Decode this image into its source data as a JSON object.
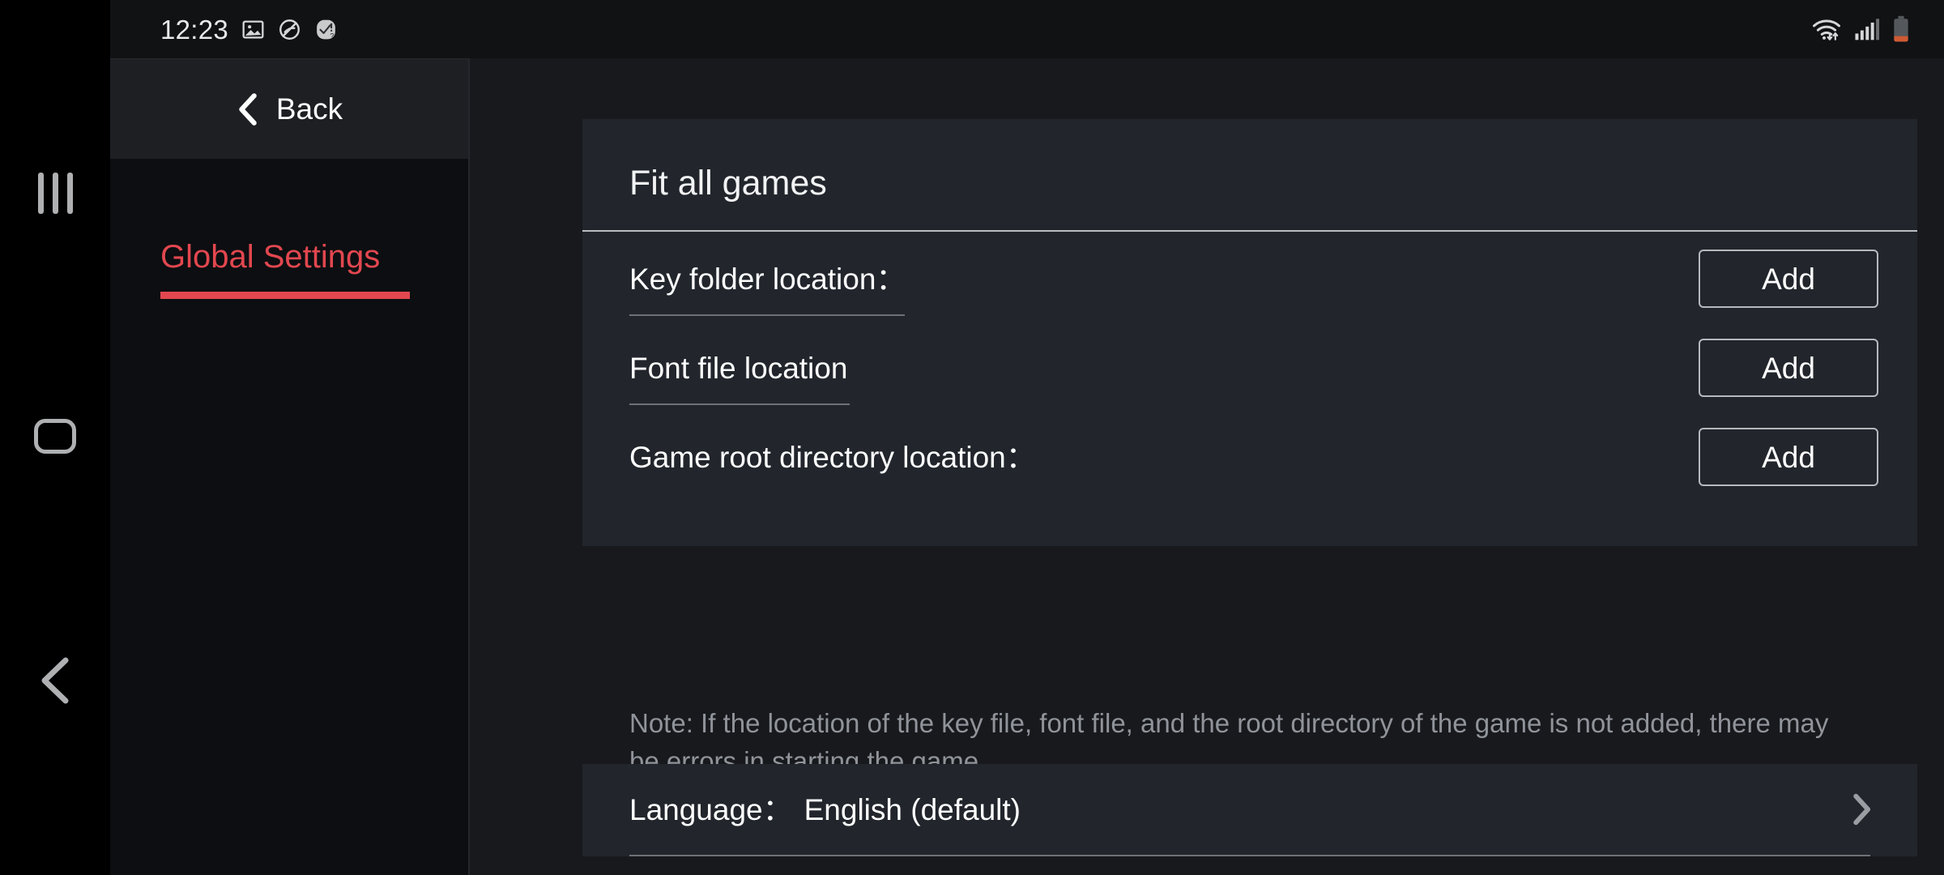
{
  "system_nav": {
    "recents_icon": "recents-icon",
    "home_icon": "home-icon",
    "back_icon": "back-icon"
  },
  "status_bar": {
    "clock": "12:23",
    "left_icons": [
      "image-icon",
      "no-entry-icon",
      "task-check-icon"
    ],
    "right_icons": [
      "wifi-icon",
      "cellular-signal-icon",
      "battery-low-icon"
    ],
    "battery_color": "#D05A33"
  },
  "sidebar": {
    "back_label": "Back",
    "back_icon": "chevron-left-icon",
    "items": [
      {
        "label": "Global Settings",
        "selected": true,
        "accent": "#E2474F"
      }
    ]
  },
  "main": {
    "fit_card": {
      "title": "Fit all games",
      "rows": [
        {
          "label": "Key folder location：",
          "value": "",
          "button": "Add",
          "has_field_line": true
        },
        {
          "label": "Font file location",
          "value": "",
          "button": "Add",
          "has_field_line": true
        },
        {
          "label": "Game root directory location：",
          "value": "",
          "button": "Add",
          "has_field_line": false
        }
      ]
    },
    "note": "Note: If the location of the key file, font file, and the root directory of the game is not added, there may be errors in starting the game.",
    "language_card": {
      "label": "Language：",
      "value": "English (default)",
      "chevron_icon": "chevron-right-icon"
    }
  }
}
